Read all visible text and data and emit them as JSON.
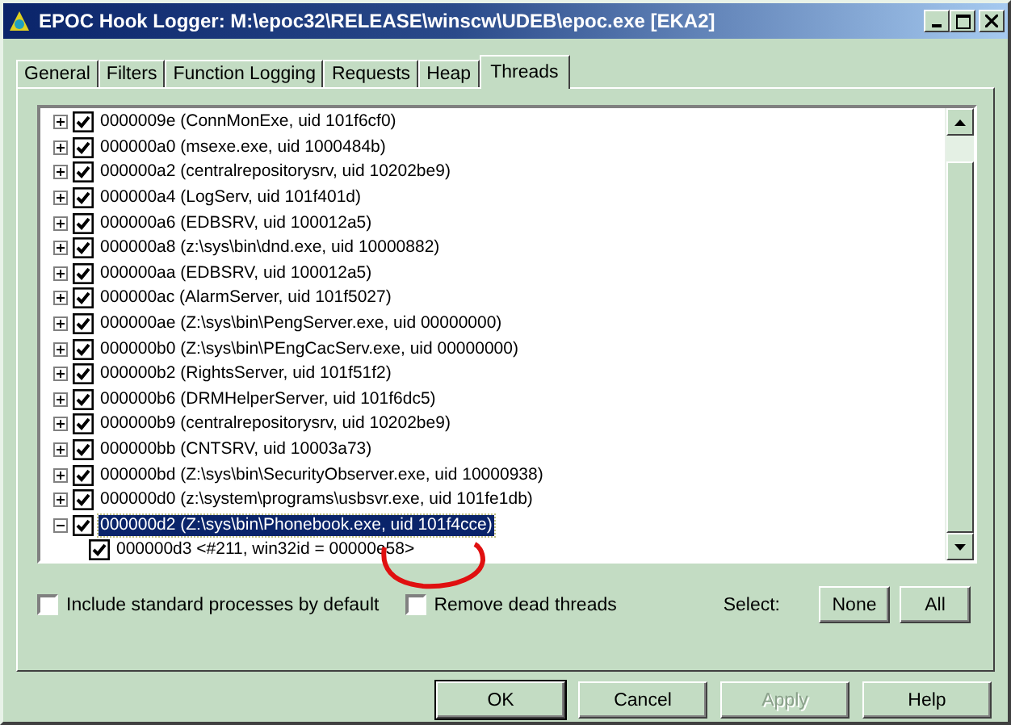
{
  "window": {
    "title": "EPOC Hook Logger: M:\\epoc32\\RELEASE\\winscw\\UDEB\\epoc.exe [EKA2]"
  },
  "tabs": [
    {
      "label": "General",
      "selected": false
    },
    {
      "label": "Filters",
      "selected": false
    },
    {
      "label": "Function Logging",
      "selected": false
    },
    {
      "label": "Requests",
      "selected": false
    },
    {
      "label": "Heap",
      "selected": false
    },
    {
      "label": "Threads",
      "selected": true
    }
  ],
  "threads": [
    {
      "label": "0000009e (ConnMonExe, uid 101f6cf0)",
      "checked": true,
      "expanded": false,
      "selected": false
    },
    {
      "label": "000000a0 (msexe.exe, uid 1000484b)",
      "checked": true,
      "expanded": false,
      "selected": false
    },
    {
      "label": "000000a2 (centralrepositorysrv, uid 10202be9)",
      "checked": true,
      "expanded": false,
      "selected": false
    },
    {
      "label": "000000a4 (LogServ, uid 101f401d)",
      "checked": true,
      "expanded": false,
      "selected": false
    },
    {
      "label": "000000a6 (EDBSRV, uid 100012a5)",
      "checked": true,
      "expanded": false,
      "selected": false
    },
    {
      "label": "000000a8 (z:\\sys\\bin\\dnd.exe, uid 10000882)",
      "checked": true,
      "expanded": false,
      "selected": false
    },
    {
      "label": "000000aa (EDBSRV, uid 100012a5)",
      "checked": true,
      "expanded": false,
      "selected": false
    },
    {
      "label": "000000ac (AlarmServer, uid 101f5027)",
      "checked": true,
      "expanded": false,
      "selected": false
    },
    {
      "label": "000000ae (Z:\\sys\\bin\\PengServer.exe, uid 00000000)",
      "checked": true,
      "expanded": false,
      "selected": false
    },
    {
      "label": "000000b0 (Z:\\sys\\bin\\PEngCacServ.exe, uid 00000000)",
      "checked": true,
      "expanded": false,
      "selected": false
    },
    {
      "label": "000000b2 (RightsServer, uid 101f51f2)",
      "checked": true,
      "expanded": false,
      "selected": false
    },
    {
      "label": "000000b6 (DRMHelperServer, uid 101f6dc5)",
      "checked": true,
      "expanded": false,
      "selected": false
    },
    {
      "label": "000000b9 (centralrepositorysrv, uid 10202be9)",
      "checked": true,
      "expanded": false,
      "selected": false
    },
    {
      "label": "000000bb (CNTSRV, uid 10003a73)",
      "checked": true,
      "expanded": false,
      "selected": false
    },
    {
      "label": "000000bd (Z:\\sys\\bin\\SecurityObserver.exe, uid 10000938)",
      "checked": true,
      "expanded": false,
      "selected": false
    },
    {
      "label": "000000d0 (z:\\system\\programs\\usbsvr.exe, uid 101fe1db)",
      "checked": true,
      "expanded": false,
      "selected": false
    },
    {
      "label": "000000d2 (Z:\\sys\\bin\\Phonebook.exe, uid 101f4cce)",
      "checked": true,
      "expanded": true,
      "selected": true,
      "children": [
        {
          "label": "000000d3 <#211, win32id = 00000e58>",
          "checked": true,
          "selected": false
        }
      ]
    }
  ],
  "options": [
    {
      "label": "Include standard processes by default",
      "checked": false
    },
    {
      "label": "Remove dead threads",
      "checked": false
    }
  ],
  "select": {
    "label": "Select:",
    "buttons": [
      "None",
      "All"
    ]
  },
  "buttons": [
    {
      "label": "OK",
      "disabled": false,
      "default": true
    },
    {
      "label": "Cancel",
      "disabled": false,
      "default": false
    },
    {
      "label": "Apply",
      "disabled": true,
      "default": false
    },
    {
      "label": "Help",
      "disabled": false,
      "default": false
    }
  ]
}
